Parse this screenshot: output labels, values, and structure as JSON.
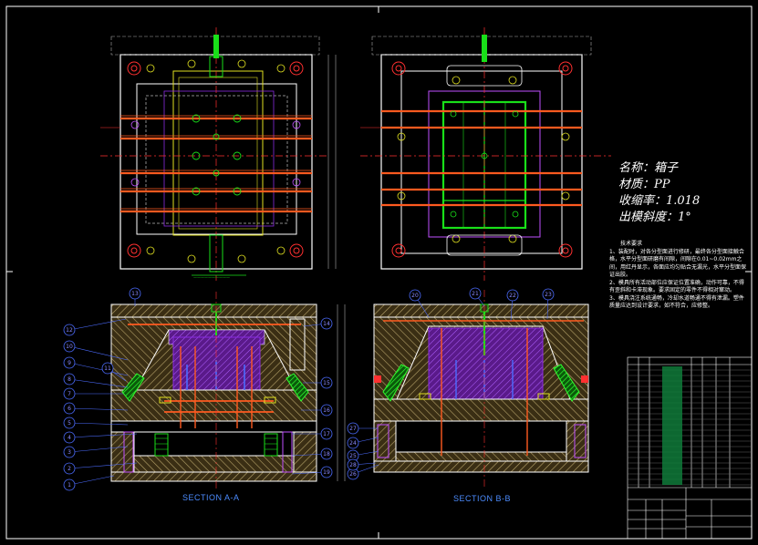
{
  "sections": {
    "a_label": "SECTION A-A",
    "b_label": "SECTION B-B"
  },
  "spec": {
    "name": "名称：箱子",
    "material": "材质：PP",
    "shrink": "收缩率：1.018",
    "draft": "出模斜度：1°"
  },
  "notes": {
    "title": "技术要求",
    "line1": "1、装配时，对各分型面进行修研，最终各分型面接触合格，水平分型面研磨有间隙，间隙在0.01~0.02mm之间，用红丹显示，各面应均匀贴合无漏光，水平分型面保证出胶。",
    "line2": "2、模具所有活动部位应保证位置准确，动作可靠，不得有歪斜和卡滞现象。要求固定的零件不得相对窜动。",
    "line3": "3、模具浇注系统通畅，冷却水道畅通不得有泄漏。塑件质量应达到设计要求，如不符合，应修整。"
  },
  "colors": {
    "outline": "#ffffff",
    "cavity": "#8a2be2",
    "hatch": "#b8a46a",
    "cooling": "#ff5a1f",
    "ejector": "#e0e020",
    "runner": "#19e019",
    "centerline": "#ff3030",
    "leader": "#4c6cff",
    "dimension": "#8a8aff"
  },
  "balloons_a": [
    "1",
    "2",
    "3",
    "4",
    "5",
    "6",
    "7",
    "8",
    "9",
    "10",
    "11",
    "12",
    "13",
    "14",
    "15",
    "16",
    "17",
    "18",
    "19"
  ],
  "balloons_b": [
    "20",
    "21",
    "22",
    "23",
    "24",
    "25",
    "26",
    "27",
    "28"
  ]
}
